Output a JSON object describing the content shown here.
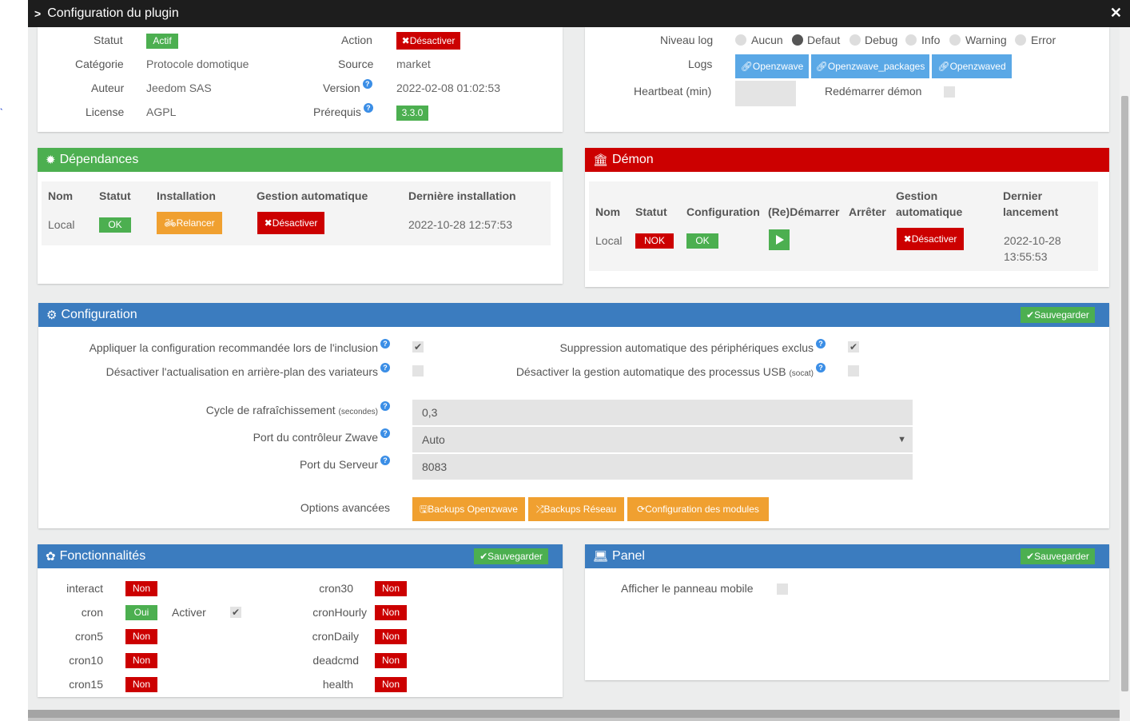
{
  "window": {
    "title": "Configuration du plugin"
  },
  "info": {
    "statut_label": "Statut",
    "statut_value": "Actif",
    "action_label": "Action",
    "action_button": "Désactiver",
    "categorie_label": "Catégorie",
    "categorie_value": "Protocole domotique",
    "source_label": "Source",
    "source_value": "market",
    "auteur_label": "Auteur",
    "auteur_value": "Jeedom SAS",
    "version_label": "Version",
    "version_value": "2022-02-08 01:02:53",
    "license_label": "License",
    "license_value": "AGPL",
    "prerequis_label": "Prérequis",
    "prerequis_value": "3.3.0"
  },
  "logs": {
    "niveau_label": "Niveau log",
    "levels": [
      "Aucun",
      "Defaut",
      "Debug",
      "Info",
      "Warning",
      "Error"
    ],
    "selected": "Defaut",
    "logs_label": "Logs",
    "log_buttons": [
      "Openzwave",
      "Openzwave_packages",
      "Openzwaved"
    ],
    "heartbeat_label": "Heartbeat (min)",
    "heartbeat_value": "",
    "restart_label": "Redémarrer démon"
  },
  "dependances": {
    "title": "Dépendances",
    "headers": [
      "Nom",
      "Statut",
      "Installation",
      "Gestion automatique",
      "Dernière installation"
    ],
    "row": {
      "nom": "Local",
      "statut": "OK",
      "installation": "Relancer",
      "gestion": "Désactiver",
      "derniere": "2022-10-28 12:57:53"
    }
  },
  "demon": {
    "title": "Démon",
    "headers": [
      "Nom",
      "Statut",
      "Configuration",
      "(Re)Démarrer",
      "Arrêter",
      "Gestion",
      "automatique",
      "Dernier",
      "lancement"
    ],
    "row": {
      "nom": "Local",
      "statut": "NOK",
      "configuration": "OK",
      "gestion": "Désactiver",
      "lancement_date": "2022-10-28",
      "lancement_time": "13:55:53"
    }
  },
  "configuration": {
    "title": "Configuration",
    "save": "Sauvegarder",
    "opt1": "Appliquer la configuration recommandée lors de l'inclusion",
    "opt2": "Désactiver l'actualisation en arrière-plan des variateurs",
    "opt3": "Suppression automatique des périphériques exclus",
    "opt4": "Désactiver la gestion automatique des processus USB",
    "opt4_sub": "(socat)",
    "cycle_label": "Cycle de rafraîchissement",
    "cycle_sub": "(secondes)",
    "cycle_value": "0,3",
    "port_label": "Port du contrôleur Zwave",
    "port_value": "Auto",
    "serveur_label": "Port du Serveur",
    "serveur_value": "8083",
    "options_label": "Options avancées",
    "btn_backup_oz": "Backups Openzwave",
    "btn_backup_res": "Backups Réseau",
    "btn_config_mod": "Configuration des modules"
  },
  "fonctionnalites": {
    "title": "Fonctionnalités",
    "save": "Sauvegarder",
    "activer": "Activer",
    "left": [
      {
        "name": "interact",
        "value": "Non"
      },
      {
        "name": "cron",
        "value": "Oui"
      },
      {
        "name": "cron5",
        "value": "Non"
      },
      {
        "name": "cron10",
        "value": "Non"
      },
      {
        "name": "cron15",
        "value": "Non"
      }
    ],
    "right": [
      {
        "name": "cron30",
        "value": "Non"
      },
      {
        "name": "cronHourly",
        "value": "Non"
      },
      {
        "name": "cronDaily",
        "value": "Non"
      },
      {
        "name": "deadcmd",
        "value": "Non"
      },
      {
        "name": "health",
        "value": "Non"
      }
    ]
  },
  "panel": {
    "title": "Panel",
    "save": "Sauvegarder",
    "mobile_label": "Afficher le panneau mobile"
  },
  "colors": {
    "green": "#4caf50",
    "red": "#cc0000",
    "blue": "#3b7cbf",
    "orange": "#f0a030",
    "lightblue": "#5aa8e6",
    "dark": "#1d1d1d"
  }
}
